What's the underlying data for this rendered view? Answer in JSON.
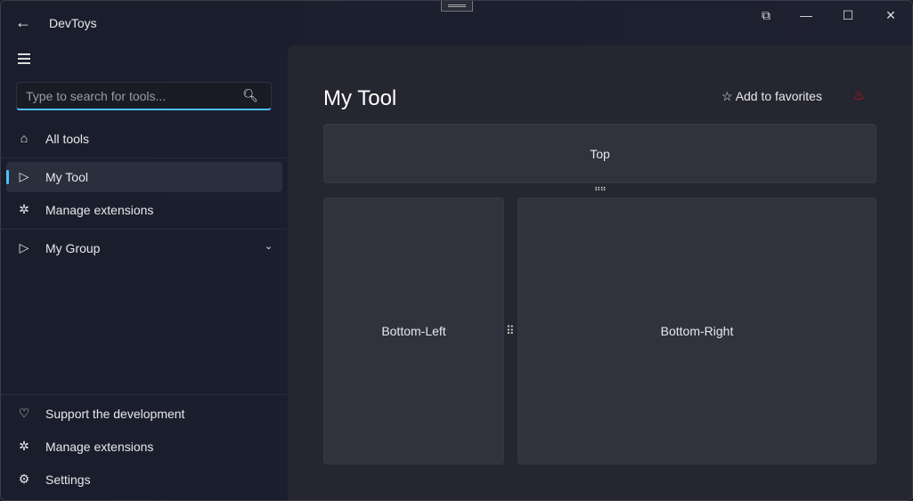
{
  "app": {
    "title": "DevToys"
  },
  "search": {
    "placeholder": "Type to search for tools..."
  },
  "sidebar": {
    "items": [
      {
        "label": "All tools",
        "icon": "home-icon"
      },
      {
        "label": "My Tool",
        "icon": "tool-icon",
        "selected": true
      },
      {
        "label": "Manage extensions",
        "icon": "puzzle-icon"
      },
      {
        "label": "My Group",
        "icon": "tool-icon",
        "expandable": true
      }
    ],
    "footer": [
      {
        "label": "Support the development",
        "icon": "heart-icon"
      },
      {
        "label": "Manage extensions",
        "icon": "puzzle-icon"
      },
      {
        "label": "Settings",
        "icon": "gear-icon"
      }
    ]
  },
  "main": {
    "title": "My Tool",
    "favorite_label": "Add to favorites",
    "panels": {
      "top": "Top",
      "bottom_left": "Bottom-Left",
      "bottom_right": "Bottom-Right"
    }
  },
  "colors": {
    "accent": "#4cc2ff",
    "fire": "#c8141e"
  }
}
